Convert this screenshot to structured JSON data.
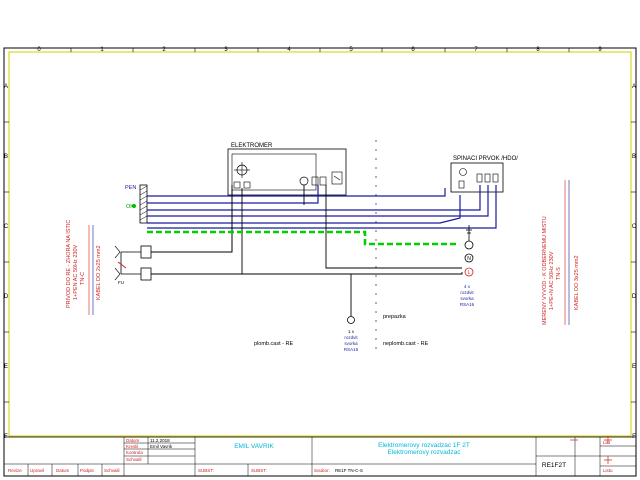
{
  "frame": {
    "columns": [
      "0",
      "1",
      "2",
      "3",
      "4",
      "5",
      "6",
      "7",
      "8",
      "9"
    ],
    "rows": [
      "A",
      "B",
      "C",
      "D",
      "E",
      "F"
    ]
  },
  "labels": {
    "elektromer": "ELEKTROMER",
    "spinaci": "SPINACI PRVOK /HDO/",
    "pen": "PEN",
    "ok": "OK",
    "left_vertical_1": "PRIVOD DO RE - ZHORA NA ISTIC",
    "left_vertical_2": "1+PEN AC 50Hz 230V",
    "left_vertical_3": "TN-C",
    "left_vertical_4": "KABEL DO 2x25 mm2",
    "right_vertical_1": "MERENY VYVOD - K ODBERNEMU MISTU",
    "right_vertical_2": "1+PE+N AC 50Hz 230V",
    "right_vertical_3": "TN-S",
    "right_vertical_4": "KABEL DO 3x25 mm2",
    "svorka_1x_1": "1 x",
    "svorka_1x_2": "rozdvit",
    "svorka_1x_3": "svorka",
    "svorka_1x_4": "RSA16",
    "svorka_4x_1": "4 x",
    "svorka_4x_2": "rozdvit",
    "svorka_4x_3": "svorka",
    "svorka_4x_4": "RSA16",
    "prepazka": "prepazka",
    "plomb": "plomb.cast - RE",
    "neplomb": "neplomb.cast - RE",
    "fu": "FU"
  },
  "title_block": {
    "datum_label": "Datum",
    "datum_value": "11.2.2018",
    "kreslil_label": "Kreslil",
    "kreslil_value": "Emil Vavrik",
    "kontrola_label": "Kontrola",
    "schvalil_label": "Schvalil",
    "author": "EMIL VAVRIK",
    "title_1": "Elektromerovy rozvadzac 1F 2T",
    "title_2": "Elektromerovy rozvadzac",
    "cols": [
      "Revize",
      "Upravil",
      "Datum",
      "Podpis",
      "Schvalil"
    ],
    "subst1": "SUBST:",
    "subst2": "SUBST:",
    "soubor": "Soubor:",
    "soubor_value": "RE1F TN-C-S",
    "drawing_no": "RE1F2T",
    "list": "List",
    "listu": "Listu"
  },
  "colors": {
    "blue": "#1a1aa0",
    "green": "#00d000",
    "red": "#d02020",
    "cyan": "#00a8c8",
    "frame_yellow": "#d8cc00"
  }
}
